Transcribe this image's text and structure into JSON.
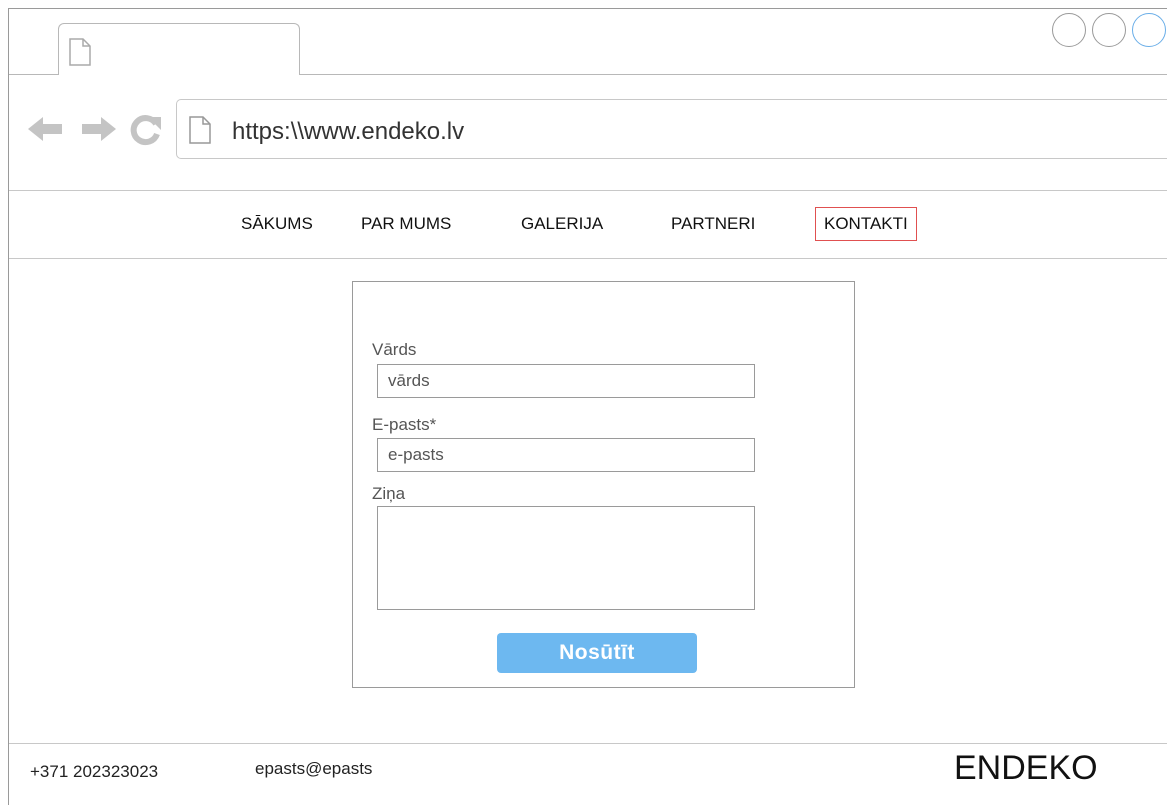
{
  "browser": {
    "url": "https:\\\\www.endeko.lv"
  },
  "nav": {
    "items": [
      {
        "label": "SĀKUMS"
      },
      {
        "label": "PAR MUMS"
      },
      {
        "label": "GALERIJA"
      },
      {
        "label": "PARTNERI"
      },
      {
        "label": "KONTAKTI",
        "active": true
      }
    ],
    "active_color": "#e05050"
  },
  "form": {
    "name_label": "Vārds",
    "name_placeholder": "vārds",
    "email_label": "E-pasts*",
    "email_placeholder": "e-pasts",
    "message_label": "Ziņa",
    "submit_label": "Nosūtīt",
    "submit_color": "#6db8f0"
  },
  "footer": {
    "phone": "+371 202323023",
    "email": "epasts@epasts",
    "brand": "ENDEKO"
  }
}
